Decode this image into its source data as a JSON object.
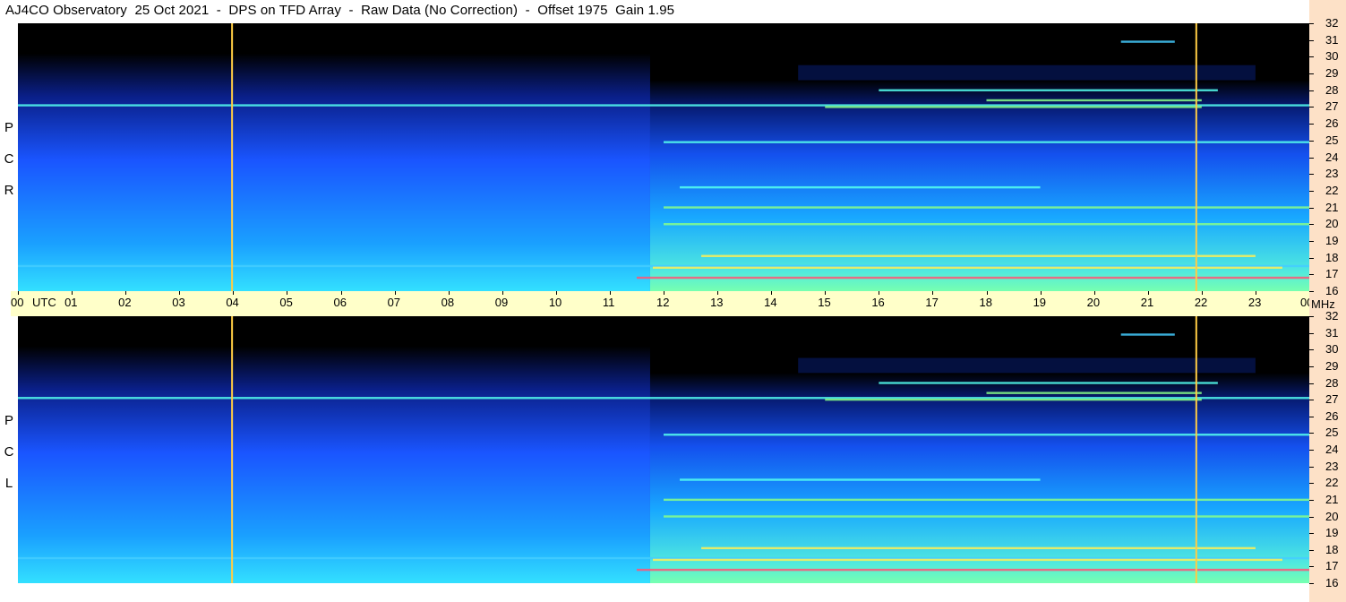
{
  "header": {
    "title": "AJ4CO Observatory  25 Oct 2021  -  DPS on TFD Array  -  Raw Data (No Correction)  -  Offset 1975  Gain 1.95"
  },
  "panels": {
    "rcp": {
      "label_letters": [
        "P",
        "C",
        "R"
      ]
    },
    "lcp": {
      "label_letters": [
        "P",
        "C",
        "L"
      ]
    }
  },
  "time_axis": {
    "unit_label": "UTC",
    "tick_labels": [
      "00",
      "01",
      "02",
      "03",
      "04",
      "05",
      "06",
      "07",
      "08",
      "09",
      "10",
      "11",
      "12",
      "13",
      "14",
      "15",
      "16",
      "17",
      "18",
      "19",
      "20",
      "21",
      "22",
      "23",
      "00"
    ],
    "freq_unit_label": "MHz"
  },
  "freq_axis": {
    "tick_labels": [
      "32",
      "31",
      "30",
      "29",
      "28",
      "27",
      "26",
      "25",
      "24",
      "23",
      "22",
      "21",
      "20",
      "19",
      "18",
      "17",
      "16"
    ]
  },
  "colors": {
    "time_strip": "#ffffc9",
    "freq_strip": "#fde1c7",
    "spectrogram_low": "#000000",
    "spectrogram_mid": "#1a55ff",
    "spectrogram_high": "#33e0ff",
    "marker_line": "#ffcc44"
  },
  "chart_data": {
    "type": "heatmap",
    "x": {
      "label": "UTC",
      "range": [
        0,
        24
      ],
      "unit": "hours"
    },
    "y": {
      "label": "MHz",
      "range": [
        16,
        32
      ]
    },
    "panels": [
      {
        "polarization": "RCP",
        "label": "R C P"
      },
      {
        "polarization": "LCP",
        "label": "L C P"
      }
    ],
    "markers_utc": [
      3.98,
      21.9
    ],
    "bands_mhz": [
      {
        "freq": 17.5,
        "start": 0,
        "end": 24,
        "intensity": 0.4
      },
      {
        "freq": 27.1,
        "start": 0,
        "end": 24,
        "intensity": 0.5
      },
      {
        "freq": 16.8,
        "start": 11.5,
        "end": 24,
        "intensity": 0.9
      },
      {
        "freq": 17.4,
        "start": 11.8,
        "end": 23.5,
        "intensity": 0.85
      },
      {
        "freq": 18.1,
        "start": 12.7,
        "end": 23,
        "intensity": 0.8
      },
      {
        "freq": 20.0,
        "start": 12,
        "end": 24,
        "intensity": 0.7
      },
      {
        "freq": 21.0,
        "start": 12,
        "end": 24,
        "intensity": 0.7
      },
      {
        "freq": 22.2,
        "start": 12.3,
        "end": 19,
        "intensity": 0.6
      },
      {
        "freq": 24.9,
        "start": 12,
        "end": 24,
        "intensity": 0.6
      },
      {
        "freq": 27.0,
        "start": 15,
        "end": 22,
        "intensity": 0.75
      },
      {
        "freq": 27.4,
        "start": 18,
        "end": 22,
        "intensity": 0.7
      },
      {
        "freq": 28.0,
        "start": 16,
        "end": 22.3,
        "intensity": 0.55
      },
      {
        "freq": 30.9,
        "start": 20.5,
        "end": 21.5,
        "intensity": 0.4
      }
    ]
  }
}
